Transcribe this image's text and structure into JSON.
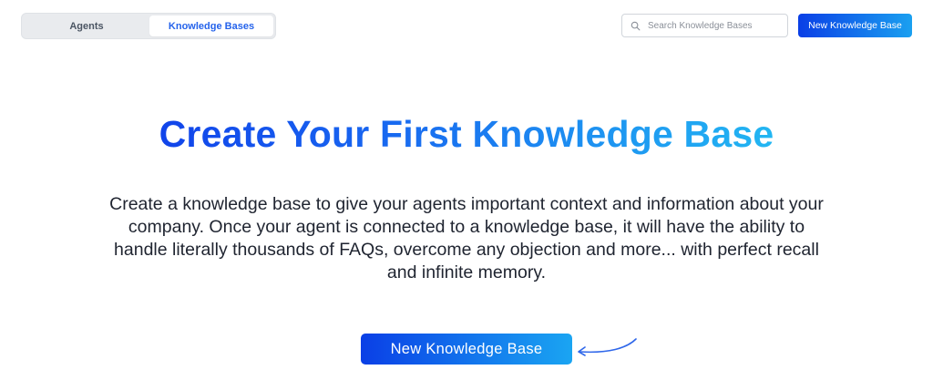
{
  "tabs": [
    {
      "label": "Agents",
      "active": false
    },
    {
      "label": "Knowledge Bases",
      "active": true
    }
  ],
  "search": {
    "placeholder": "Search Knowledge Bases",
    "value": "",
    "icon": "search-icon"
  },
  "header": {
    "new_button_label": "New Knowledge Base"
  },
  "main": {
    "title": "Create Your First Knowledge Base",
    "description": "Create a knowledge base to give your agents important context and information about your company. Once your agent is connected to a knowledge base, it will have the ability to handle literally thousands of FAQs, overcome any objection and more... with perfect recall and infinite memory.",
    "cta_label": "New Knowledge Base",
    "cta_arrow_icon": "curved-arrow-icon"
  },
  "colors": {
    "accent_start": "#0a3fe6",
    "accent_end": "#1aa5f2",
    "active_tab_text": "#2563eb"
  }
}
